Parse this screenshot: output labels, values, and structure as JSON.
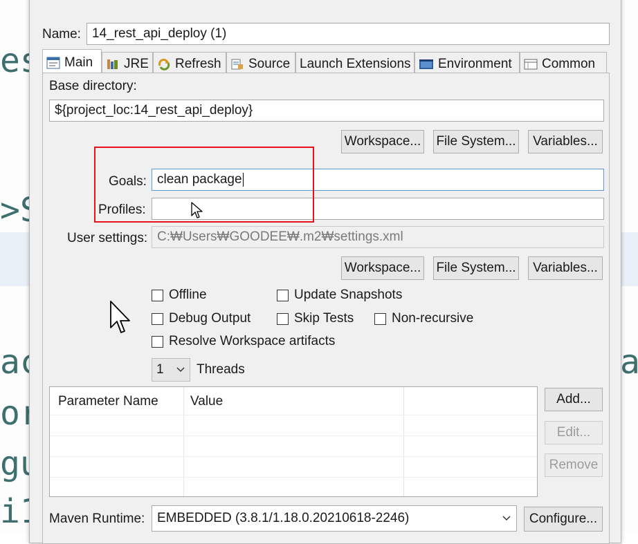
{
  "background_code": {
    "lines": [
      "es",
      ">S",
      "ac",
      "or",
      "gu",
      "i1"
    ],
    "right_fragment": "a"
  },
  "dialog": {
    "name_label": "Name:",
    "name_value": "14_rest_api_deploy (1)",
    "tabs": [
      {
        "label": "Main",
        "icon": "main-tab-icon",
        "active": true
      },
      {
        "label": "JRE",
        "icon": "jre-icon"
      },
      {
        "label": "Refresh",
        "icon": "refresh-icon"
      },
      {
        "label": "Source",
        "icon": "source-icon"
      },
      {
        "label": "Launch Extensions",
        "icon": ""
      },
      {
        "label": "Environment",
        "icon": "environment-icon"
      },
      {
        "label": "Common",
        "icon": "common-icon"
      }
    ],
    "base_directory_label": "Base directory:",
    "base_directory_value": "${project_loc:14_rest_api_deploy}",
    "buttons_row1": {
      "workspace": "Workspace...",
      "file_system": "File System...",
      "variables": "Variables..."
    },
    "goals_label": "Goals:",
    "goals_value": "clean package",
    "profiles_label": "Profiles:",
    "profiles_value": "",
    "user_settings_label": "User settings:",
    "user_settings_value": "C:₩Users₩GOODEE₩.m2₩settings.xml",
    "buttons_row2": {
      "workspace": "Workspace...",
      "file_system": "File System...",
      "variables": "Variables..."
    },
    "checkboxes": {
      "offline": "Offline",
      "update_snapshots": "Update Snapshots",
      "debug_output": "Debug Output",
      "skip_tests": "Skip Tests",
      "non_recursive": "Non-recursive",
      "resolve_workspace": "Resolve Workspace artifacts"
    },
    "threads_value": "1",
    "threads_label": "Threads",
    "param_table": {
      "headers": [
        "Parameter Name",
        "Value"
      ]
    },
    "param_buttons": {
      "add": "Add...",
      "edit": "Edit...",
      "remove": "Remove"
    },
    "maven_runtime_label": "Maven Runtime:",
    "maven_runtime_value": "EMBEDDED (3.8.1/1.18.0.20210618-2246)",
    "configure_label": "Configure..."
  },
  "colors": {
    "highlight": "#e8121c",
    "focus_border": "#5b9bd5",
    "code_text": "#3d6f6e"
  }
}
